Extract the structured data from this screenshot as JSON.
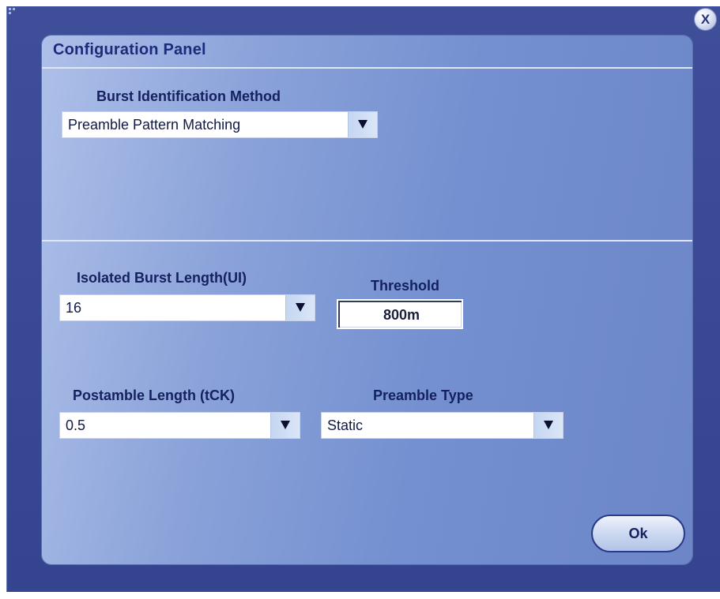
{
  "window": {
    "close_label": "X"
  },
  "panel": {
    "title": "Configuration Panel",
    "burst_identification": {
      "label": "Burst Identification Method",
      "selected": "Preamble Pattern Matching"
    },
    "isolated_burst_length": {
      "label": "Isolated Burst Length(UI)",
      "selected": "16"
    },
    "threshold": {
      "label": "Threshold",
      "value": "800m"
    },
    "postamble_length": {
      "label": "Postamble Length (tCK)",
      "selected": "0.5"
    },
    "preamble_type": {
      "label": "Preamble Type",
      "selected": "Static"
    },
    "ok_label": "Ok"
  },
  "colors": {
    "window_bg": "#3e4e98",
    "panel_bg_light": "#aec0e9",
    "panel_bg_dark": "#6c86c8",
    "label_text": "#15205f",
    "title_text": "#1e2a7a"
  },
  "icons": {
    "dropdown": "triangle-down-icon",
    "close": "close-icon",
    "resize": "resize-grip-icon"
  }
}
